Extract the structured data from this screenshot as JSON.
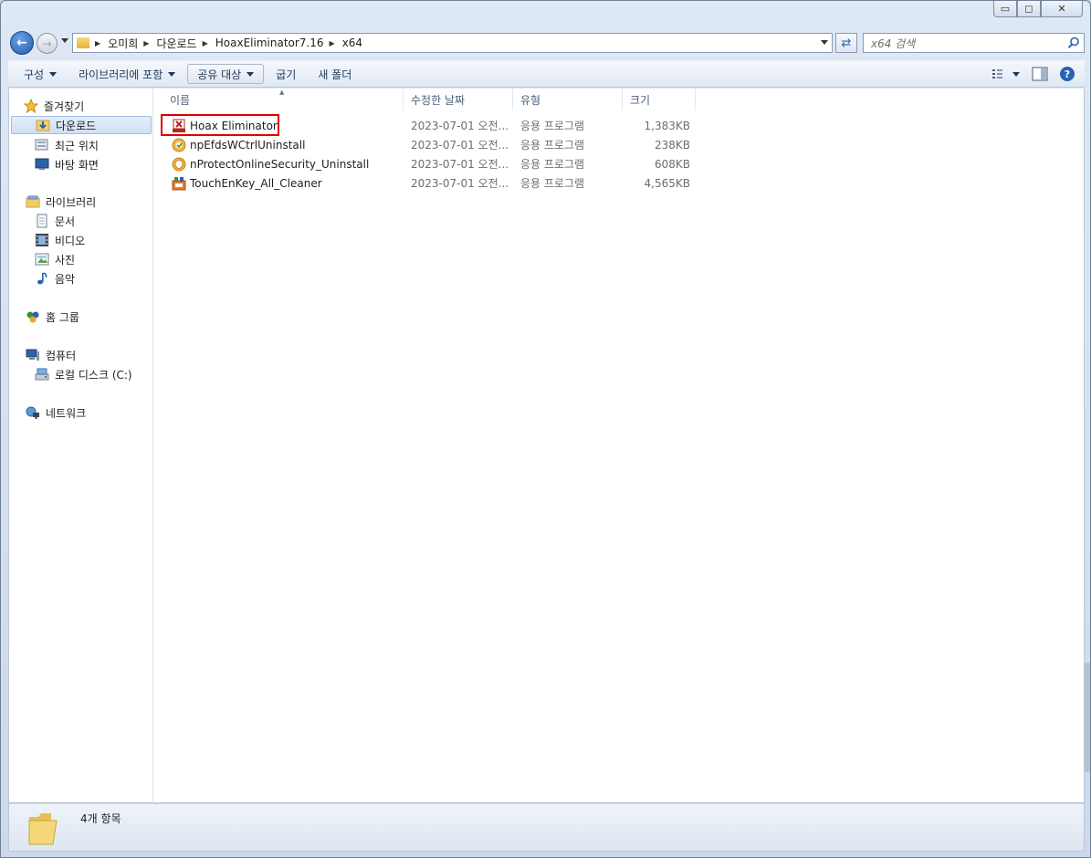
{
  "window": {
    "controls": {
      "minimize": "▭",
      "maximize": "◻",
      "close": "✕"
    }
  },
  "address": {
    "crumbs": [
      "오미희",
      "다운로드",
      "HoaxEliminator7.16",
      "x64"
    ]
  },
  "search": {
    "placeholder": "x64 검색"
  },
  "toolbar": {
    "organize": "구성",
    "include_library": "라이브러리에 포함",
    "share_with": "공유 대상",
    "burn": "굽기",
    "new_folder": "새 폴더"
  },
  "nav": {
    "favorites": "즐겨찾기",
    "downloads": "다운로드",
    "recent": "최근 위치",
    "desktop": "바탕 화면",
    "libraries": "라이브러리",
    "documents": "문서",
    "videos": "비디오",
    "pictures": "사진",
    "music": "음악",
    "homegroup": "홈 그룹",
    "computer": "컴퓨터",
    "local_disk": "로컬 디스크 (C:)",
    "network": "네트워크"
  },
  "columns": {
    "name": "이름",
    "date": "수정한 날짜",
    "type": "유형",
    "size": "크기"
  },
  "files": [
    {
      "name": "Hoax Eliminator",
      "date": "2023-07-01 오전...",
      "type": "응용 프로그램",
      "size": "1,383KB",
      "icon": "hoax-eliminator-icon"
    },
    {
      "name": "npEfdsWCtrlUninstall",
      "date": "2023-07-01 오전...",
      "type": "응용 프로그램",
      "size": "238KB",
      "icon": "npefds-icon"
    },
    {
      "name": "nProtectOnlineSecurity_Uninstall",
      "date": "2023-07-01 오전...",
      "type": "응용 프로그램",
      "size": "608KB",
      "icon": "nprotect-shield-icon"
    },
    {
      "name": "TouchEnKey_All_Cleaner",
      "date": "2023-07-01 오전...",
      "type": "응용 프로그램",
      "size": "4,565KB",
      "icon": "touchenkey-icon"
    }
  ],
  "status": {
    "count": "4개 항목"
  },
  "colors": {
    "highlight": "#e00000",
    "accent": "#1f5aa8"
  }
}
